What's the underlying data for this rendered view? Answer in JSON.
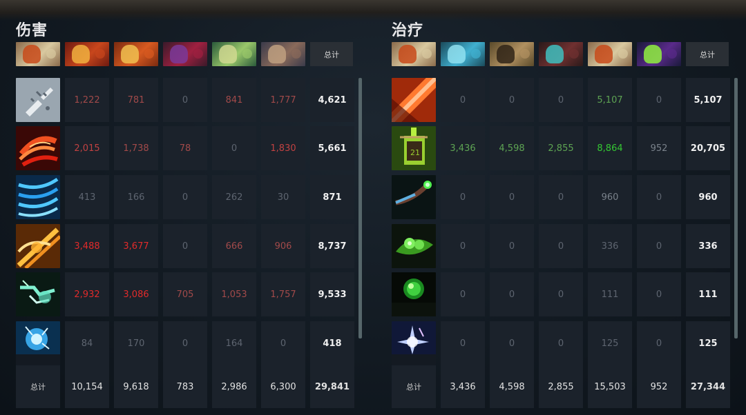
{
  "damage": {
    "title": "伤害",
    "total_header": "总计",
    "total_row_label": "总计",
    "heroes": [
      "hero-damage-1",
      "hero-damage-2",
      "hero-damage-3",
      "hero-damage-4",
      "hero-damage-5",
      "hero-damage-6"
    ],
    "rows": [
      {
        "icon": "broken-sword-icon",
        "values": [
          "1,222",
          "781",
          "0",
          "841",
          "1,777"
        ],
        "total": "4,621",
        "colors": [
          "red1",
          "red1",
          "dim",
          "red1",
          "red1"
        ]
      },
      {
        "icon": "fire-whirl-icon",
        "values": [
          "2,015",
          "1,738",
          "78",
          "0",
          "1,830"
        ],
        "total": "5,661",
        "colors": [
          "red2",
          "red1",
          "red1",
          "dim",
          "red2"
        ]
      },
      {
        "icon": "blue-blades-icon",
        "values": [
          "413",
          "166",
          "0",
          "262",
          "30"
        ],
        "total": "871",
        "colors": [
          "dim",
          "dim",
          "dim",
          "dim",
          "dim"
        ]
      },
      {
        "icon": "golden-slash-icon",
        "values": [
          "3,488",
          "3,677",
          "0",
          "666",
          "906"
        ],
        "total": "8,737",
        "colors": [
          "red3",
          "red3",
          "dim",
          "red1",
          "red1"
        ]
      },
      {
        "icon": "electric-hand-icon",
        "values": [
          "2,932",
          "3,086",
          "705",
          "1,053",
          "1,757"
        ],
        "total": "9,533",
        "colors": [
          "red3",
          "red3",
          "red1",
          "red1",
          "red1"
        ]
      },
      {
        "icon": "lightning-orb-icon",
        "values": [
          "84",
          "170",
          "0",
          "164",
          "0"
        ],
        "total": "418",
        "colors": [
          "dim",
          "dim",
          "dim",
          "dim",
          "dim"
        ]
      }
    ],
    "totals": [
      "10,154",
      "9,618",
      "783",
      "2,986",
      "6,300"
    ],
    "grand_total": "29,841"
  },
  "healing": {
    "title": "治疗",
    "total_header": "总计",
    "total_row_label": "总计",
    "heroes": [
      "hero-heal-1",
      "hero-heal-2",
      "hero-heal-3",
      "hero-heal-4",
      "hero-heal-5",
      "hero-heal-6"
    ],
    "rows": [
      {
        "icon": "orange-slash-icon",
        "values": [
          "0",
          "0",
          "0",
          "5,107",
          "0"
        ],
        "total": "5,107",
        "colors": [
          "dim",
          "dim",
          "dim",
          "grn1",
          "dim"
        ]
      },
      {
        "icon": "healing-banner-icon",
        "values": [
          "3,436",
          "4,598",
          "2,855",
          "8,864",
          "952"
        ],
        "total": "20,705",
        "colors": [
          "grn1",
          "grn1",
          "grn1",
          "grn2",
          "gry"
        ]
      },
      {
        "icon": "green-staff-icon",
        "values": [
          "0",
          "0",
          "0",
          "960",
          "0"
        ],
        "total": "960",
        "colors": [
          "dim",
          "dim",
          "dim",
          "gry",
          "dim"
        ]
      },
      {
        "icon": "leaf-orbs-icon",
        "values": [
          "0",
          "0",
          "0",
          "336",
          "0"
        ],
        "total": "336",
        "colors": [
          "dim",
          "dim",
          "dim",
          "dim",
          "dim"
        ]
      },
      {
        "icon": "green-orb-icon",
        "values": [
          "0",
          "0",
          "0",
          "111",
          "0"
        ],
        "total": "111",
        "colors": [
          "dim",
          "dim",
          "dim",
          "dim",
          "dim"
        ]
      },
      {
        "icon": "blue-sparkle-icon",
        "values": [
          "0",
          "0",
          "0",
          "125",
          "0"
        ],
        "total": "125",
        "colors": [
          "dim",
          "dim",
          "dim",
          "dim",
          "dim"
        ]
      }
    ],
    "totals": [
      "3,436",
      "4,598",
      "2,855",
      "15,503",
      "952"
    ],
    "grand_total": "27,344"
  }
}
